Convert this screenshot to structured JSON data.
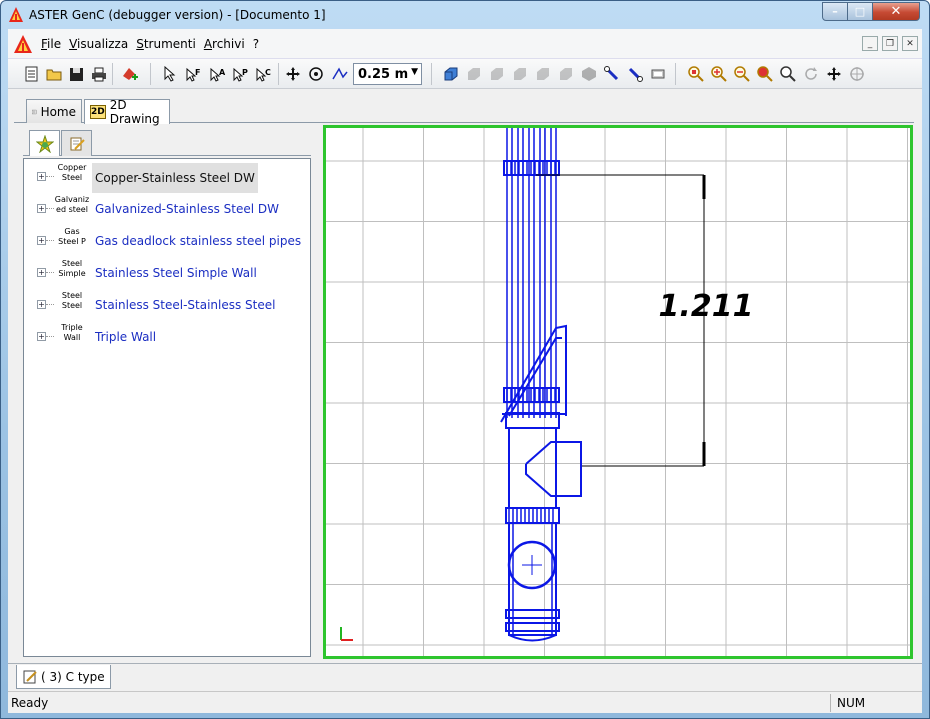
{
  "window": {
    "title": "ASTER GenC (debugger version) - [Documento 1]",
    "caption_buttons": {
      "minimize": "–",
      "maximize": "□",
      "close": "✕"
    }
  },
  "menubar": {
    "items": [
      {
        "label": "File",
        "accel": "F"
      },
      {
        "label": "Visualizza",
        "accel": "V"
      },
      {
        "label": "Strumenti",
        "accel": "S"
      },
      {
        "label": "Archivi",
        "accel": "A"
      },
      {
        "label": "?",
        "accel": ""
      }
    ],
    "mdi_buttons": {
      "minimize": "_",
      "restore": "❐",
      "close": "✕"
    }
  },
  "toolbar": {
    "scale_value": "0.25 m",
    "icons": [
      "new-icon",
      "open-icon",
      "save-icon",
      "print-icon",
      "add-component-icon",
      "select-arrow-icon",
      "select-multiple-icon",
      "select-a-icon",
      "select-p-icon",
      "select-c-icon",
      "pan-icon",
      "rotate-icon",
      "polyline-icon",
      "view-iso-front-icon",
      "view-iso-back-icon",
      "view-iso-left-icon",
      "view-iso-right-icon",
      "view-iso-top-icon",
      "view-iso-bottom-icon",
      "solid-icon",
      "wrench-icon",
      "wrench-b-icon",
      "frame-icon",
      "zoom-window-icon",
      "zoom-in-icon",
      "zoom-out-icon",
      "zoom-all-icon",
      "zoom-realtime-icon",
      "refresh-icon",
      "move-view-icon",
      "orbit-icon"
    ]
  },
  "doc_tabs": [
    {
      "label": "Home",
      "active": false
    },
    {
      "label": "2D Drawing",
      "active": true,
      "badge": "2D"
    }
  ],
  "left_panel": {
    "tabs": [
      {
        "icon": "star-icon"
      },
      {
        "icon": "notes-icon"
      }
    ],
    "tree": [
      {
        "thumb": "Copper Steel",
        "label": "Copper-Stainless Steel DW",
        "selected": true
      },
      {
        "thumb": "Galvaniz ed steel",
        "label": "Galvanized-Stainless Steel DW",
        "selected": false
      },
      {
        "thumb": "Gas Steel P",
        "label": "Gas deadlock stainless steel pipes",
        "selected": false
      },
      {
        "thumb": "Steel Simple",
        "label": "Stainless Steel Simple Wall",
        "selected": false
      },
      {
        "thumb": "Steel Steel",
        "label": "Stainless Steel-Stainless Steel",
        "selected": false
      },
      {
        "thumb": "Triple Wall",
        "label": "Triple Wall",
        "selected": false
      }
    ]
  },
  "drawing": {
    "dimension_label": "1.211",
    "stroke_color": "#0b17e6",
    "frame_color": "#2ec52e",
    "grid_color": "#bfbfbf",
    "dimension_color": "#000000",
    "axis_colors": {
      "x": "#e02020",
      "y": "#22b522"
    }
  },
  "bottom_tab": {
    "label": "( 3) C type"
  },
  "status": {
    "text": "Ready",
    "num": "NUM"
  }
}
